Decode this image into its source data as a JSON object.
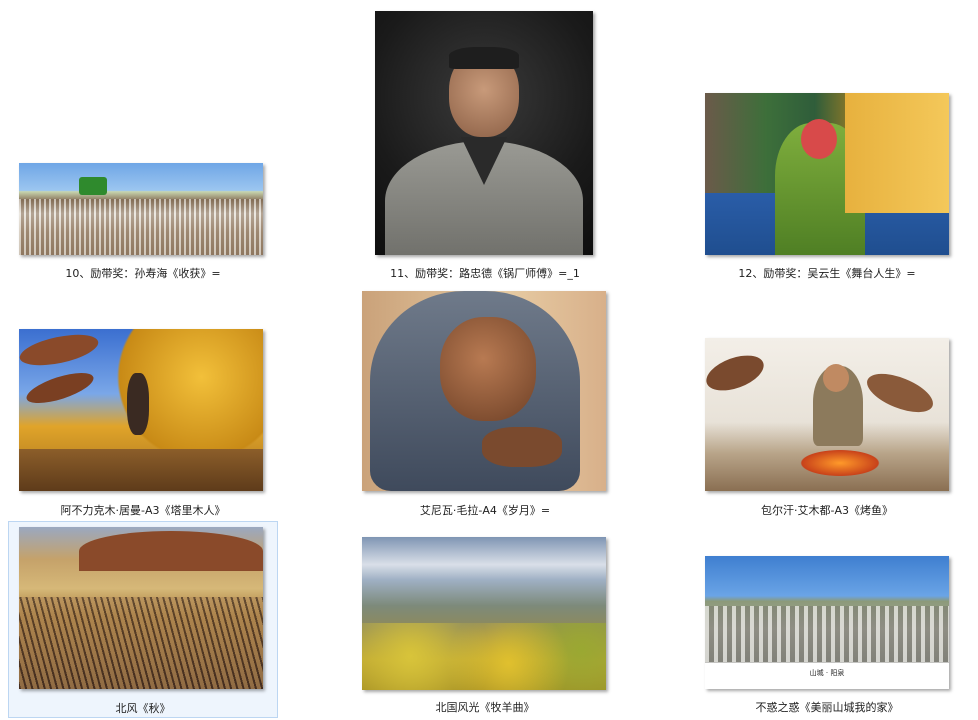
{
  "items": [
    {
      "caption": "10、励带奖：孙寿海《收获》="
    },
    {
      "caption": "11、励带奖：路忠德《锅厂师傅》=_1"
    },
    {
      "caption": "12、励带奖：吴云生《舞台人生》="
    },
    {
      "caption": "阿不力克木·居曼-A3《塔里木人》"
    },
    {
      "caption": "艾尼瓦·毛拉-A4《岁月》="
    },
    {
      "caption": "包尔汗·艾木都-A3《烤鱼》"
    },
    {
      "caption": "北风《秋》"
    },
    {
      "caption": "北国风光《牧羊曲》"
    },
    {
      "caption": "不惑之惑《美丽山城我的家》",
      "image_text": "山城 · 阳泉"
    }
  ]
}
